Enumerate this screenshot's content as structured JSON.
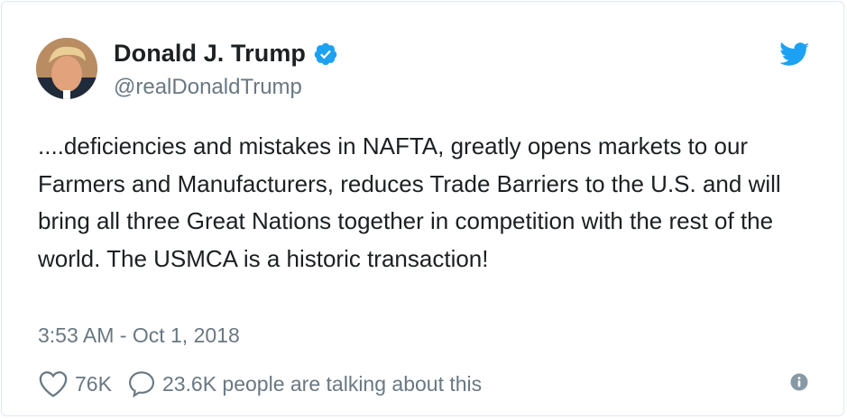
{
  "author": {
    "name": "Donald J. Trump",
    "handle": "@realDonaldTrump",
    "verified": true
  },
  "tweet": {
    "text": "....deficiencies and mistakes in NAFTA, greatly opens markets to our Farmers and Manufacturers, reduces Trade Barriers to the U.S. and will bring all three Great Nations together in competition with the rest of the world. The USMCA is a historic transaction!",
    "timestamp": "3:53 AM - Oct 1, 2018"
  },
  "actions": {
    "likes": "76K",
    "talking": "23.6K people are talking about this"
  },
  "icons": {
    "brand": "twitter-bird-icon",
    "verified": "verified-badge-icon",
    "like": "heart-icon",
    "reply": "speech-bubble-icon",
    "info": "info-icon"
  },
  "colors": {
    "brand_blue": "#1da1f2",
    "text": "#1c2022",
    "muted": "#697882",
    "border": "#e1e8ed"
  }
}
